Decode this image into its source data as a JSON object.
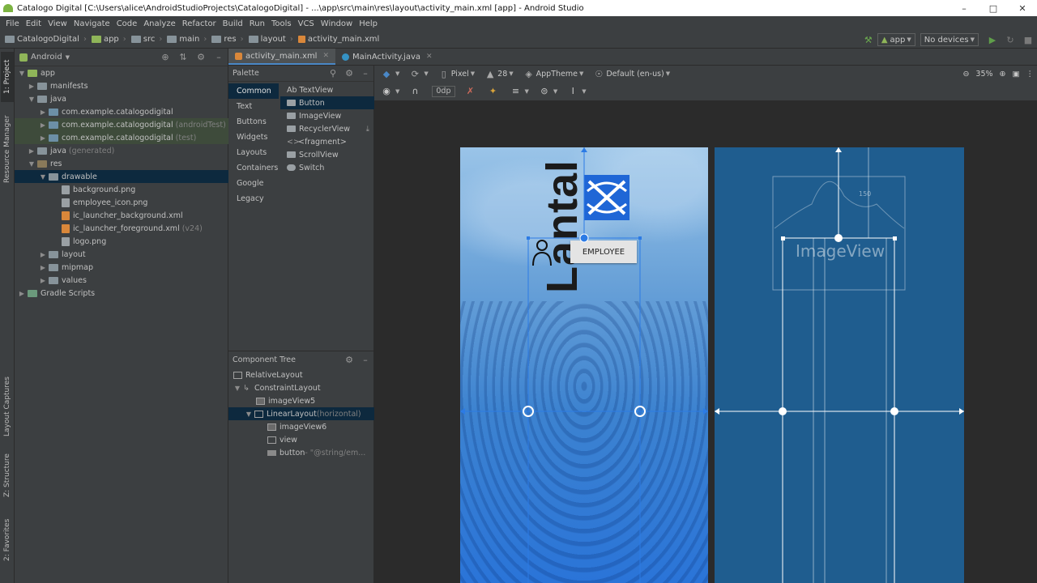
{
  "window": {
    "title": "Catalogo Digital [C:\\Users\\alice\\AndroidStudioProjects\\CatalogoDigital] - ...\\app\\src\\main\\res\\layout\\activity_main.xml [app] - Android Studio"
  },
  "menu": [
    "File",
    "Edit",
    "View",
    "Navigate",
    "Code",
    "Analyze",
    "Refactor",
    "Build",
    "Run",
    "Tools",
    "VCS",
    "Window",
    "Help"
  ],
  "breadcrumb": [
    "CatalogoDigital",
    "app",
    "src",
    "main",
    "res",
    "layout",
    "activity_main.xml"
  ],
  "run_config": {
    "module": "app",
    "device": "No devices"
  },
  "side_tabs": {
    "project": "1: Project",
    "resource_manager": "Resource Manager",
    "layout_captures": "Layout Captures",
    "structure": "Z: Structure",
    "favorites": "2: Favorites"
  },
  "project_panel": {
    "view_mode": "Android",
    "tree": [
      {
        "label": "app",
        "extra": ""
      },
      {
        "label": "manifests",
        "extra": ""
      },
      {
        "label": "java",
        "extra": ""
      },
      {
        "label": "com.example.catalogodigital",
        "extra": ""
      },
      {
        "label": "com.example.catalogodigital",
        "extra": "(androidTest)"
      },
      {
        "label": "com.example.catalogodigital",
        "extra": "(test)"
      },
      {
        "label": "java",
        "extra": "(generated)"
      },
      {
        "label": "res",
        "extra": ""
      },
      {
        "label": "drawable",
        "extra": ""
      },
      {
        "label": "background.png",
        "extra": ""
      },
      {
        "label": "employee_icon.png",
        "extra": ""
      },
      {
        "label": "ic_launcher_background.xml",
        "extra": ""
      },
      {
        "label": "ic_launcher_foreground.xml",
        "extra": "(v24)"
      },
      {
        "label": "logo.png",
        "extra": ""
      },
      {
        "label": "layout",
        "extra": ""
      },
      {
        "label": "mipmap",
        "extra": ""
      },
      {
        "label": "values",
        "extra": ""
      },
      {
        "label": "Gradle Scripts",
        "extra": ""
      }
    ]
  },
  "editor_tabs": [
    "activity_main.xml",
    "MainActivity.java"
  ],
  "palette": {
    "title": "Palette",
    "categories": [
      "Common",
      "Text",
      "Buttons",
      "Widgets",
      "Layouts",
      "Containers",
      "Google",
      "Legacy"
    ],
    "items": [
      "Ab TextView",
      "Button",
      "ImageView",
      "RecyclerView",
      "<fragment>",
      "ScrollView",
      "Switch"
    ]
  },
  "component_tree": {
    "title": "Component Tree",
    "rows": [
      {
        "label": "RelativeLayout",
        "extra": ""
      },
      {
        "label": "ConstraintLayout",
        "extra": ""
      },
      {
        "label": "imageView5",
        "extra": ""
      },
      {
        "label": "LinearLayout",
        "extra": "(horizontal)"
      },
      {
        "label": "imageView6",
        "extra": ""
      },
      {
        "label": "view",
        "extra": ""
      },
      {
        "label": "button",
        "extra": "- \"@string/em..."
      }
    ]
  },
  "design_toolbar": {
    "device": "Pixel",
    "api": "28",
    "theme": "AppTheme",
    "locale": "Default (en-us)",
    "zoom": "35%",
    "margin": "0dp"
  },
  "preview": {
    "logo_text": "Lantal",
    "button_label": "EMPLOYEE",
    "blueprint_label": "ImageView",
    "blueprint_number": "150"
  },
  "colors": {
    "accent": "#4a88c7",
    "selection": "#0d293e",
    "blueprint": "#1f5d8f",
    "logo_blue": "#1f66d6"
  }
}
